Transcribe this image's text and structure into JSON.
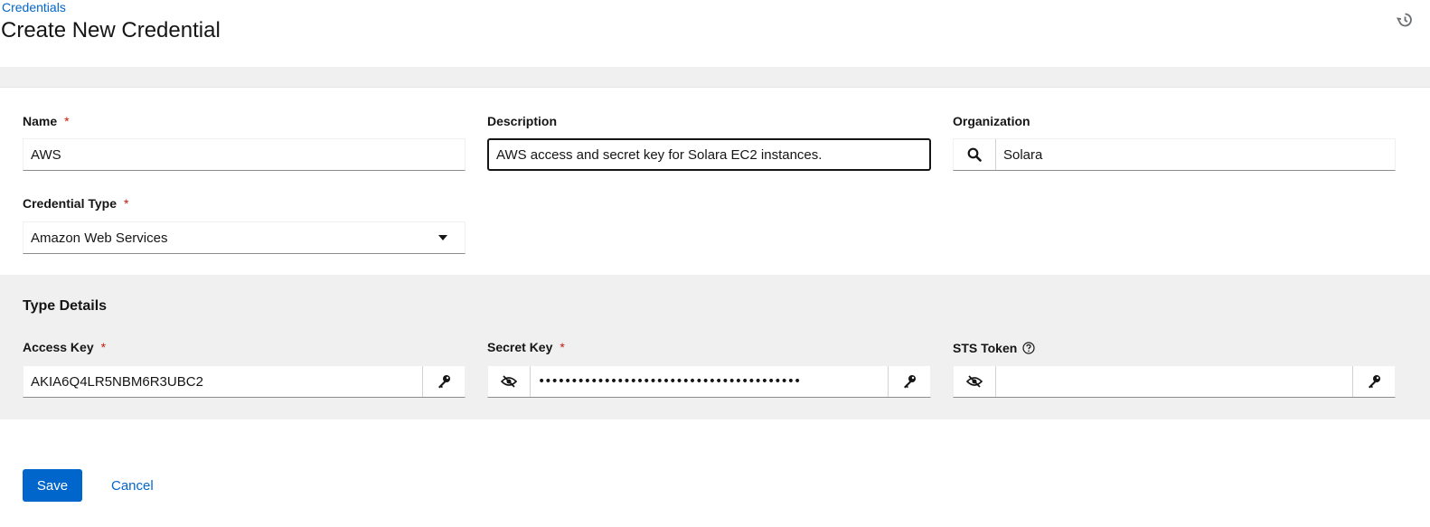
{
  "header": {
    "breadcrumb": "Credentials",
    "title": "Create New Credential",
    "history_icon": "history-icon"
  },
  "form": {
    "name": {
      "label": "Name",
      "required": "*",
      "value": "AWS"
    },
    "description": {
      "label": "Description",
      "value": "AWS access and secret key for Solara EC2 instances."
    },
    "organization": {
      "label": "Organization",
      "value": "Solara",
      "icon": "search-icon"
    },
    "credential_type": {
      "label": "Credential Type",
      "required": "*",
      "value": "Amazon Web Services"
    }
  },
  "type_details": {
    "title": "Type Details",
    "access_key": {
      "label": "Access Key",
      "required": "*",
      "value": "AKIA6Q4LR5NBM6R3UBC2",
      "icon": "key-icon"
    },
    "secret_key": {
      "label": "Secret Key",
      "required": "*",
      "value": "••••••••••••••••••••••••••••••••••••••••",
      "icon": "key-icon",
      "toggle_icon": "eye-slash-icon"
    },
    "sts_token": {
      "label": "STS Token",
      "value": "",
      "icon": "key-icon",
      "toggle_icon": "eye-slash-icon",
      "help_icon": "help-icon"
    }
  },
  "actions": {
    "save_label": "Save",
    "cancel_label": "Cancel"
  },
  "colors": {
    "accent": "#0066cc",
    "required": "#c9190b",
    "section_bg": "#f0f0f0"
  }
}
